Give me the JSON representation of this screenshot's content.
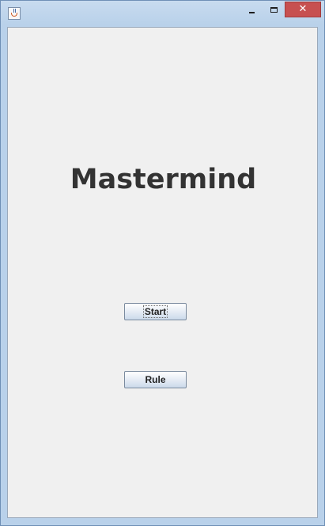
{
  "window": {
    "title": "",
    "icon": "java-cup-icon",
    "controls": {
      "minimize_icon": "minimize-icon",
      "maximize_icon": "maximize-icon",
      "close_symbol": "✕"
    },
    "colors": {
      "frame": "#b9d1ea",
      "close": "#c75050",
      "content": "#f0f0f0"
    }
  },
  "main": {
    "title": "Mastermind",
    "buttons": {
      "start_label": "Start",
      "rule_label": "Rule"
    }
  }
}
